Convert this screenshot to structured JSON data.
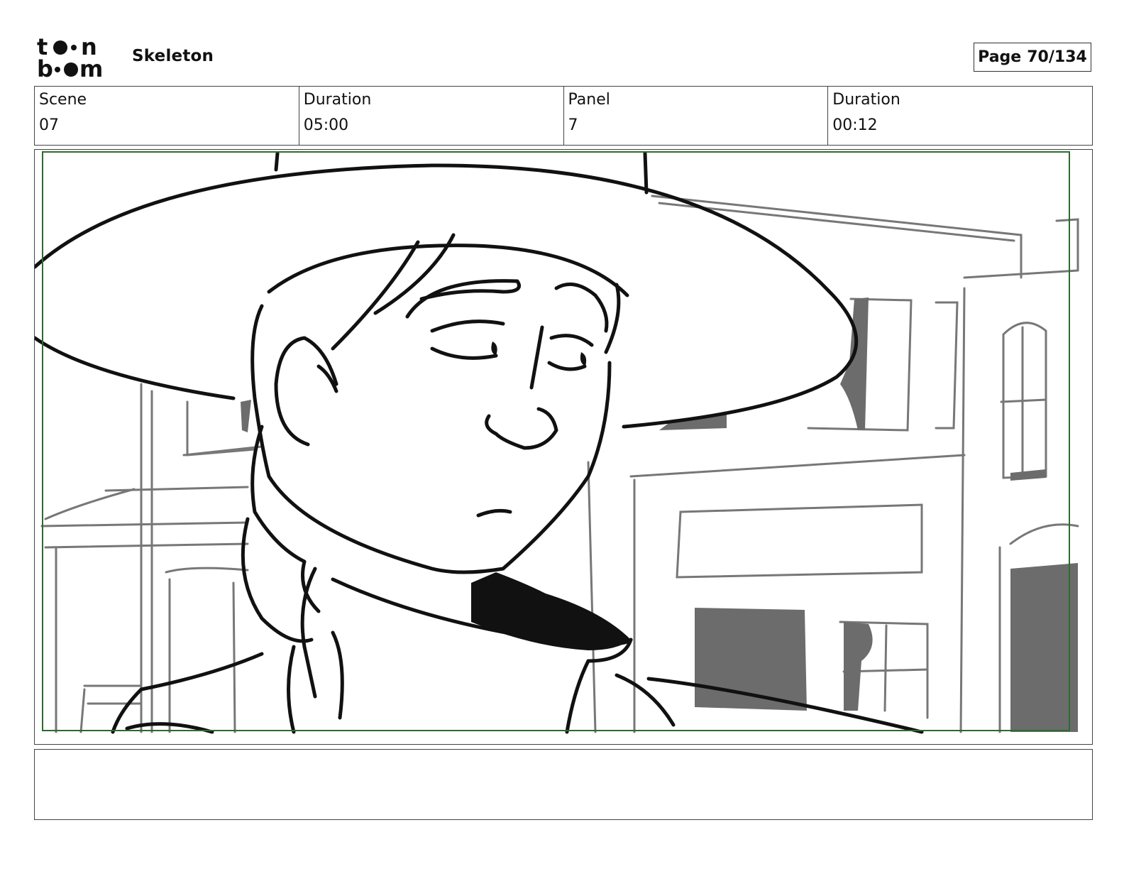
{
  "header": {
    "logo_top": "to•n",
    "logo_bottom": "b••m",
    "project_title": "Skeleton",
    "page_label": "Page",
    "page_number": "70/134"
  },
  "info": [
    {
      "label": "Scene",
      "value": "07"
    },
    {
      "label": "Duration",
      "value": "05:00"
    },
    {
      "label": "Panel",
      "value": "7"
    },
    {
      "label": "Duration",
      "value": "00:12"
    }
  ],
  "panel": {
    "frame_color": "#2e6b2e",
    "ink_color": "#000000",
    "background_sketch_color": "#777777",
    "image_description": "storyboard-drawing-woman-in-wide-brim-hat"
  },
  "notes": {
    "text": ""
  }
}
